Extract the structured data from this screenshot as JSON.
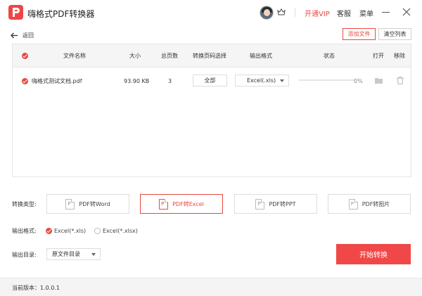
{
  "app": {
    "title": "嗨格式PDF转换器",
    "vip_label": "开通VIP",
    "support_label": "客服",
    "menu_label": "菜单",
    "accent": "#e8483f"
  },
  "toolbar": {
    "back_label": "返回",
    "add_file_label": "添加文件",
    "clear_list_label": "清空列表"
  },
  "table": {
    "columns": {
      "name": "文件名称",
      "size": "大小",
      "pages": "总页数",
      "page_select": "转换页码选择",
      "format": "输出格式",
      "status": "状态",
      "open": "打开",
      "remove": "移除"
    },
    "rows": [
      {
        "checked": true,
        "name": "嗨格式测试文档.pdf",
        "size": "93.90 KB",
        "pages": "3",
        "page_select": "全部",
        "format": "Excel(.xls)",
        "progress_pct": 0,
        "progress_label": "0%"
      }
    ]
  },
  "options": {
    "type_label": "转换类型:",
    "types": [
      {
        "label": "PDF转Word",
        "active": false
      },
      {
        "label": "PDF转Excel",
        "active": true
      },
      {
        "label": "PDF转PPT",
        "active": false
      },
      {
        "label": "PDF转图片",
        "active": false
      }
    ],
    "format_label": "输出格式:",
    "formats": [
      {
        "label": "Excel(*.xls)",
        "selected": true
      },
      {
        "label": "Excel(*.xlsx)",
        "selected": false
      }
    ],
    "dir_label": "输出目录:",
    "dir_value": "原文件目录",
    "start_label": "开始转换"
  },
  "footer": {
    "version": "当前版本：1.0.0.1"
  }
}
